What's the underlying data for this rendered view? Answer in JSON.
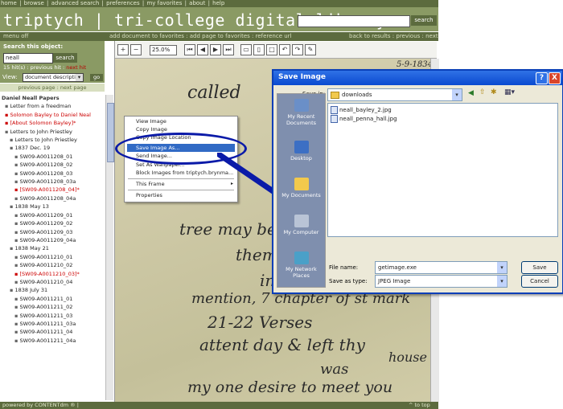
{
  "topnav": {
    "items": [
      "home",
      "browse",
      "advanced search",
      "preferences",
      "my favorites",
      "about",
      "help"
    ]
  },
  "banner": {
    "title": "triptych | tri-college digital library",
    "search_label": "search"
  },
  "subnav": {
    "menu_off": "menu off",
    "center": "add document to favorites : add page to favorites : reference url",
    "right": "back to results : previous : next"
  },
  "sidebar": {
    "search_label": "Search this object:",
    "search_value": "neall",
    "search_button": "search",
    "hits_prefix": "15 hit(s) : ",
    "hits_prev": "previous hit",
    "hits_sep": " : ",
    "hits_next": "next hit",
    "view_label": "View:",
    "view_value": "document description",
    "go": "go",
    "pager": "previous page : next page",
    "collection": "Daniel Neall Papers",
    "tree": [
      {
        "label": "Letter from a freedman",
        "red": false,
        "star": false
      },
      {
        "label": "Solomon Bayley to Daniel Neal",
        "red": true,
        "star": false
      },
      {
        "label": "[About Solomon Bayley]",
        "red": true,
        "star": true
      },
      {
        "label": "Letters to John Priestley",
        "red": false,
        "star": false
      },
      {
        "label": "Letters to John Priestley",
        "red": false,
        "star": false
      },
      {
        "label": "1837 Dec. 19",
        "red": false,
        "star": false
      },
      {
        "label": "SW09-A0011208_01",
        "red": false,
        "star": false
      },
      {
        "label": "SW09-A0011208_02",
        "red": false,
        "star": false
      },
      {
        "label": "SW09-A0011208_03",
        "red": false,
        "star": false
      },
      {
        "label": "SW09-A0011208_03a",
        "red": false,
        "star": false
      },
      {
        "label": "[SW09-A0011208_04]",
        "red": true,
        "star": true
      },
      {
        "label": "SW09-A0011208_04a",
        "red": false,
        "star": false
      },
      {
        "label": "1838 May 13",
        "red": false,
        "star": false
      },
      {
        "label": "SW09-A0011209_01",
        "red": false,
        "star": false
      },
      {
        "label": "SW09-A0011209_02",
        "red": false,
        "star": false
      },
      {
        "label": "SW09-A0011209_03",
        "red": false,
        "star": false
      },
      {
        "label": "SW09-A0011209_04a",
        "red": false,
        "star": false
      },
      {
        "label": "1838 May 21",
        "red": false,
        "star": false
      },
      {
        "label": "SW09-A0011210_01",
        "red": false,
        "star": false
      },
      {
        "label": "SW09-A0011210_02",
        "red": false,
        "star": false
      },
      {
        "label": "[SW09-A0011210_03]",
        "red": true,
        "star": true
      },
      {
        "label": "SW09-A0011210_04",
        "red": false,
        "star": false
      },
      {
        "label": "1838 July 31",
        "red": false,
        "star": false
      },
      {
        "label": "SW09-A0011211_01",
        "red": false,
        "star": false
      },
      {
        "label": "SW09-A0011211_02",
        "red": false,
        "star": false
      },
      {
        "label": "SW09-A0011211_03",
        "red": false,
        "star": false
      },
      {
        "label": "SW09-A0011211_03a",
        "red": false,
        "star": false
      },
      {
        "label": "SW09-A0011211_04",
        "red": false,
        "star": false
      },
      {
        "label": "SW09-A0011211_04a",
        "red": false,
        "star": false
      }
    ]
  },
  "footer": {
    "left": "powered by CONTENTdm ® |",
    "right": "^ to top"
  },
  "viewer": {
    "zoom": "25.0%",
    "date": "5-9-1834"
  },
  "manuscript": {
    "lines": [
      "called",
      "them 7 thing",
      "in th",
      "tree may befor",
      "mention, 7 chapter of st mark",
      "21-22 Verses",
      "attent day & left thy",
      "house",
      "was",
      "my one desire to meet you"
    ]
  },
  "context_menu": {
    "items": [
      "View Image",
      "Copy Image",
      "Copy Image Location",
      "Save Image As...",
      "Send Image...",
      "Set As Wallpaper...",
      "Block Images from triptych.brynma...",
      "This Frame",
      "Properties"
    ],
    "highlighted_index": 3
  },
  "dialog": {
    "title": "Save Image",
    "save_in_label": "Save in:",
    "save_in_value": "downloads",
    "places": [
      "My Recent Documents",
      "Desktop",
      "My Documents",
      "My Computer",
      "My Network Places"
    ],
    "files": [
      "neall_bayley_2.jpg",
      "neall_penna_hall.jpg"
    ],
    "file_name_label": "File name:",
    "file_name_value": "getimage.exe",
    "save_type_label": "Save as type:",
    "save_type_value": "JPEG Image",
    "save_button": "Save",
    "cancel_button": "Cancel",
    "help_button": "?",
    "close_button": "X"
  },
  "colors": {
    "nav_dark": "#5c6b3e",
    "banner": "#8a9a64",
    "highlight": "#316ac5",
    "annotation": "#0a1aa8"
  }
}
